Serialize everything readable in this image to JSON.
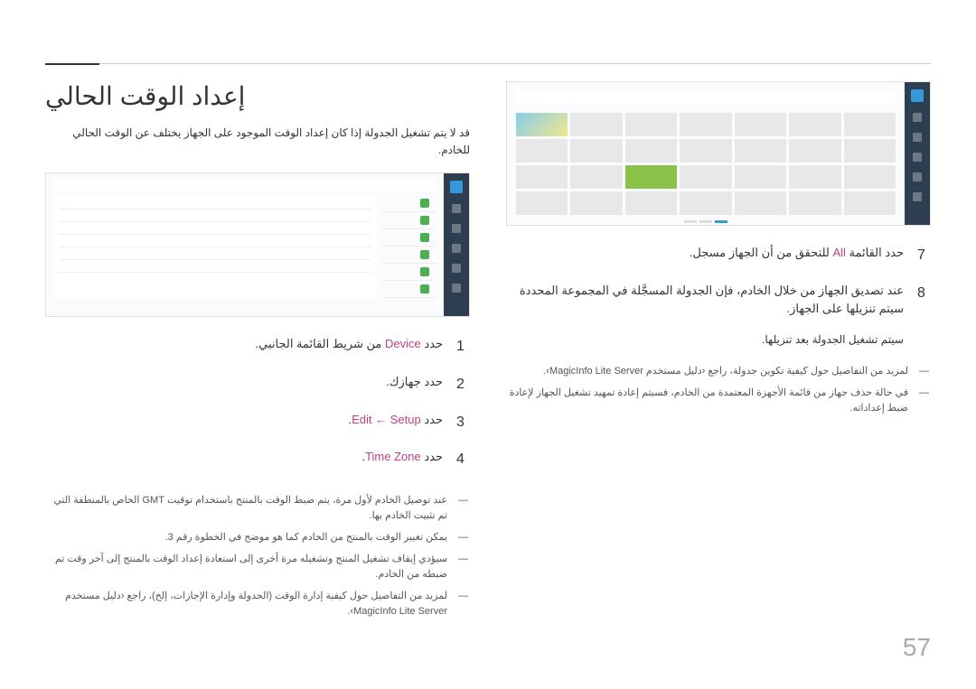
{
  "meta": {
    "page_number": "57"
  },
  "right_col": {
    "steps": [
      {
        "num": "7",
        "text_prefix": "حدد القائمة ",
        "highlight": "All",
        "text_suffix": " للتحقق من أن الجهاز مسجل."
      },
      {
        "num": "8",
        "text": "عند تصديق الجهاز من خلال الخادم، فإن الجدولة المسجَّلة في المجموعة المحددة سيتم تنزيلها على الجهاز."
      }
    ],
    "sub_text": "سيتم تشغيل الجدولة بعد تنزيلها.",
    "notes": [
      "لمزيد من التفاصيل حول كيفية تكوين جدولة، راجع ‹دليل مستخدم MagicInfo Lite Server›.",
      "في حالة حذف جهاز من قائمة الأجهزة المعتمدة من الخادم، فسيتم إعادة تمهيد تشغيل الجهاز لإعادة ضبط إعداداته."
    ]
  },
  "left_col": {
    "title": "إعداد الوقت الحالي",
    "description": "قد لا يتم تشغيل الجدولة إذا كان إعداد الوقت الموجود على الجهاز يختلف عن الوقت الحالي للخادم.",
    "steps": [
      {
        "num": "1",
        "prefix": "حدد ",
        "hl": "Device",
        "suffix": " من شريط القائمة الجانبي."
      },
      {
        "num": "2",
        "text": "حدد جهازك."
      },
      {
        "num": "3",
        "prefix": "حدد ",
        "hl_full": "Edit ← Setup",
        "suffix": "."
      },
      {
        "num": "4",
        "prefix": "حدد ",
        "hl": "Time Zone",
        "suffix": "."
      }
    ],
    "notes": [
      "عند توصيل الخادم لأول مرة، يتم ضبط الوقت بالمنتج باستخدام توقيت GMT الخاص بالمنطقة التي تم تثبيت الخادم بها.",
      "يمكن تغيير الوقت بالمنتج من الخادم كما هو موضح في الخطوة رقم 3.",
      "سيؤدي إيقاف تشغيل المنتج وتشغيله مرة أخرى إلى استعادة إعداد الوقت بالمنتج إلى آخر وقت تم ضبطه من الخادم.",
      "لمزيد من التفاصيل حول كيفية إدارة الوقت (الجدولة وإدارة الإجازات، إلخ)، راجع ‹دليل مستخدم MagicInfo Lite Server›."
    ]
  }
}
